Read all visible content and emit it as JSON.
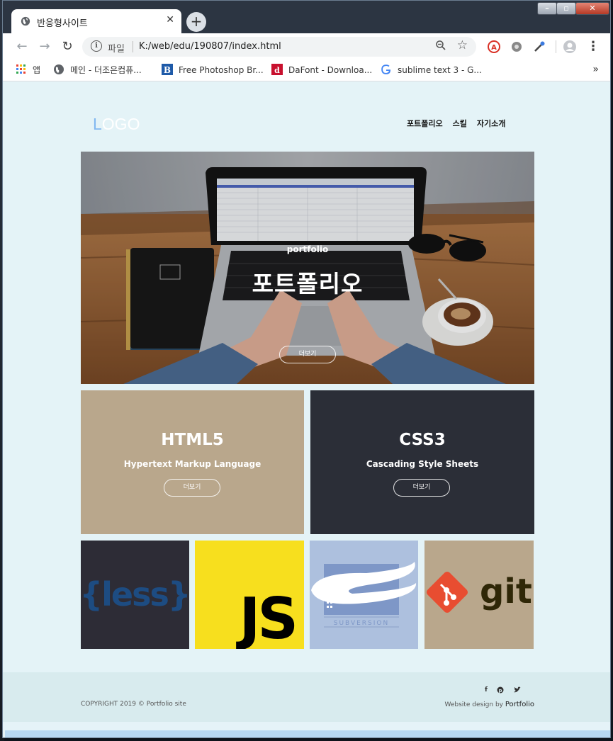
{
  "browser": {
    "tab_title": "반응형사이트",
    "tab_close": "✕",
    "new_tab": "+",
    "url_scheme": "파일",
    "url": "K:/web/edu/190807/index.html",
    "window_controls": {
      "minimize": "–",
      "maximize": "▫",
      "close": "✕"
    },
    "bookmarks": [
      {
        "label": "앱",
        "icon": "apps-grid-icon"
      },
      {
        "label": "메인 - 더조은컴퓨...",
        "icon": "globe-icon"
      },
      {
        "label": "Free Photoshop Br...",
        "icon": "brusheezy-icon"
      },
      {
        "label": "DaFont - Downloa...",
        "icon": "dafont-icon"
      },
      {
        "label": "sublime text 3 - G...",
        "icon": "google-icon"
      }
    ],
    "bookmarks_more": "»"
  },
  "header": {
    "logo_first": "L",
    "logo_rest": "OGO",
    "nav": [
      "포트폴리오",
      "스킬",
      "자기소개"
    ]
  },
  "hero": {
    "subtitle": "portfolio",
    "title": "포트폴리오",
    "button": "더보기"
  },
  "cards": [
    {
      "title": "HTML5",
      "description": "Hypertext Markup Language",
      "button": "더보기",
      "color": "#b9a78c"
    },
    {
      "title": "CSS3",
      "description": "Cascading Style Sheets",
      "button": "더보기",
      "color": "#2b2e37"
    }
  ],
  "skills": [
    {
      "name": "less",
      "logo_text": "{less}",
      "color": "#2d2c36"
    },
    {
      "name": "javascript",
      "logo_text": "JS",
      "color": "#f7df1e"
    },
    {
      "name": "subversion",
      "logo_text": "SUBVERSION",
      "color": "#adc0de"
    },
    {
      "name": "git",
      "logo_text": "git",
      "color": "#b9a78c"
    }
  ],
  "footer": {
    "copyright": "COPYRIGHT 2019 © Portfolio site",
    "social": [
      "f",
      "p",
      "t"
    ],
    "credit_prefix": "Website design by ",
    "credit_link": "Portfolio"
  },
  "colors": {
    "page_bg": "#e4f3f7",
    "footer_bg": "#d8ebee",
    "logo_accent": "#82b8f0",
    "tabstrip": "#2c3542"
  }
}
